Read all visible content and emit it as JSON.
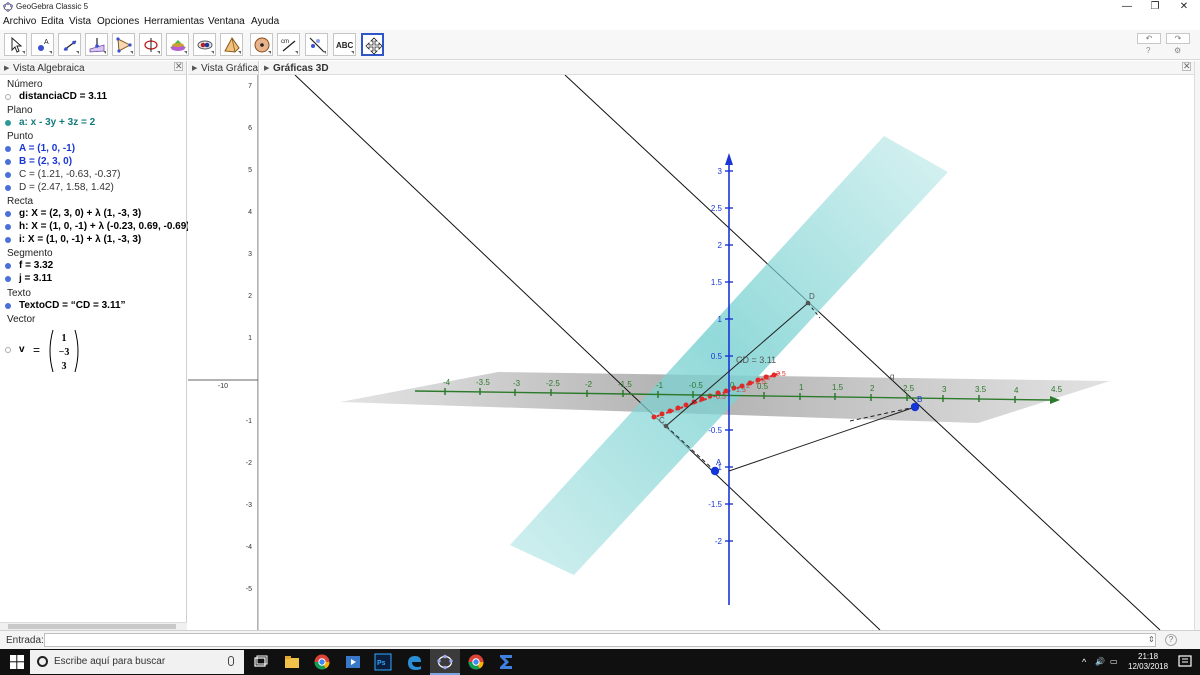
{
  "window": {
    "title": "GeoGebra Classic 5",
    "minimize": "—",
    "maximize": "❐",
    "close": "✕"
  },
  "menu": [
    "Archivo",
    "Edita",
    "Vista",
    "Opciones",
    "Herramientas",
    "Ventana",
    "Ayuda"
  ],
  "toolbar": {
    "tools": [
      "move-tool",
      "point-tool",
      "line-tool",
      "perpendicular-tool",
      "polygon-tool",
      "circle-tool",
      "intersect-surfaces-tool",
      "pyramid-tool",
      "sphere-tool",
      "rotate-view-tool",
      "distance-tool",
      "reflect-tool",
      "text-tool",
      "move-graphics-view-tool"
    ],
    "distance_label": "cm",
    "text_label": "ABC",
    "undo": "↶",
    "redo": "↷",
    "help": "?",
    "settings": "⚙"
  },
  "algebra": {
    "title": "Vista Algebraica",
    "close": "✕",
    "categories": {
      "numero": "Número",
      "plano": "Plano",
      "punto": "Punto",
      "recta": "Recta",
      "segmento": "Segmento",
      "texto": "Texto",
      "vector": "Vector"
    },
    "items": {
      "distanciaCD": "distanciaCD = 3.11",
      "plane_a": "a: x - 3y + 3z = 2",
      "point_A": "A = (1, 0, -1)",
      "point_B": "B = (2, 3, 0)",
      "point_C": "C = (1.21, -0.63, -0.37)",
      "point_D": "D = (2.47, 1.58, 1.42)",
      "line_g": "g: X = (2, 3, 0) + λ (1, -3, 3)",
      "line_h": "h: X = (1, 0, -1) + λ (-0.23, 0.69, -0.69)",
      "line_i": "i: X = (1, 0, -1) + λ (1, -3, 3)",
      "segment_f": "f = 3.32",
      "segment_j": "j = 3.11",
      "text_CD": "TextoCD = “CD = 3.11”",
      "vector_v_name": "v",
      "vector_v_eq": "=",
      "vector_v_values": [
        "1",
        "−3",
        "3"
      ]
    }
  },
  "graphics2d": {
    "title": "Vista Gráfica",
    "y_ticks": [
      "7",
      "6",
      "5",
      "4",
      "3",
      "2",
      "1",
      "-1",
      "-2",
      "-3",
      "-4",
      "-5"
    ],
    "x_tick": "-10"
  },
  "graphics3d": {
    "title": "Gráficas 3D",
    "close": "✕",
    "z_ticks": [
      "3",
      "2.5",
      "2",
      "1.5",
      "1",
      "0.5",
      "-0.5",
      "-1",
      "-1.5",
      "-2"
    ],
    "y_ticks": [
      "-4",
      "-3.5",
      "-3",
      "-2.5",
      "-2",
      "-1.5",
      "-1",
      "-0.5",
      "0",
      "0.5",
      "1",
      "1.5",
      "2",
      "2.5",
      "3",
      "3.5",
      "4",
      "4.5"
    ],
    "x_ticks": [
      "0.5",
      "1",
      "1.5",
      "2",
      "2.5",
      "3",
      "3.5"
    ],
    "labels": {
      "D": "D",
      "C": "C",
      "B": "B",
      "A": "A",
      "g": "g",
      "distance": "CD = 3.11"
    },
    "colors": {
      "plane": "#7fd3d3",
      "floor": "#8a8a8a",
      "z_axis": "#1a35d4",
      "y_axis": "#2c7a2c",
      "x_axis": "#e02a2a",
      "point": "#1436d6"
    }
  },
  "input": {
    "label": "Entrada:",
    "value": "",
    "help": "?",
    "dropdown": "⇕"
  },
  "taskbar": {
    "search_placeholder": "Escribe aquí para buscar",
    "time": "21:18",
    "date": "12/03/2018",
    "ps_label": "Ps"
  }
}
